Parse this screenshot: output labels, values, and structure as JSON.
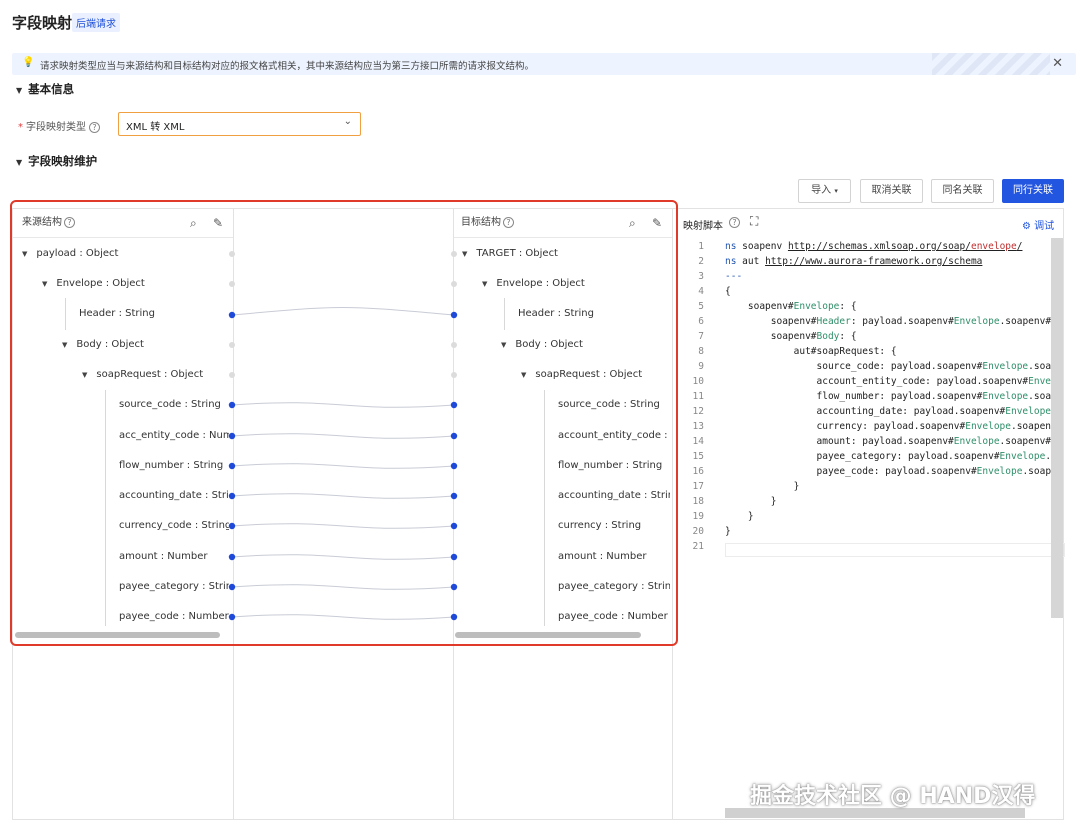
{
  "header": {
    "title": "字段映射",
    "tag": "后端请求"
  },
  "alert": {
    "text": "请求映射类型应当与来源结构和目标结构对应的报文格式相关，其中来源结构应当为第三方接口所需的请求报文结构。",
    "icon": "info-bulb-icon",
    "close": "✕"
  },
  "basic": {
    "section_title": "基本信息",
    "field_label": "字段映射类型",
    "field_value": "XML 转 XML"
  },
  "maint": {
    "section_title": "字段映射维护"
  },
  "toolbar": {
    "import": "导入",
    "cancel": "取消关联",
    "same_name": "同名关联",
    "row": "同行关联"
  },
  "source": {
    "title": "来源结构",
    "nodes": [
      "payload : Object",
      "Envelope : Object",
      "Header : String",
      "Body : Object",
      "soapRequest : Object",
      "source_code : String",
      "acc_entity_code : Number",
      "flow_number : String",
      "accounting_date : String",
      "currency_code : String",
      "amount : Number",
      "payee_category : String",
      "payee_code : Number"
    ]
  },
  "target": {
    "title": "目标结构",
    "nodes": [
      "TARGET : Object",
      "Envelope : Object",
      "Header : String",
      "Body : Object",
      "soapRequest : Object",
      "source_code : String",
      "account_entity_code : Number",
      "flow_number : String",
      "accounting_date : String",
      "currency : String",
      "amount : Number",
      "payee_category : String",
      "payee_code : Number"
    ]
  },
  "script": {
    "title": "映射脚本",
    "debug": "调试",
    "line_numbers": [
      "1",
      "2",
      "3",
      "4",
      "5",
      "6",
      "7",
      "8",
      "9",
      "10",
      "11",
      "12",
      "13",
      "14",
      "15",
      "16",
      "17",
      "18",
      "19",
      "20",
      "21"
    ]
  },
  "watermark": "掘金技术社区 @ HAND汉得",
  "colors": {
    "accent": "#2255e0",
    "highlight_border": "#e03a2a",
    "dot": "#1f49d8"
  }
}
